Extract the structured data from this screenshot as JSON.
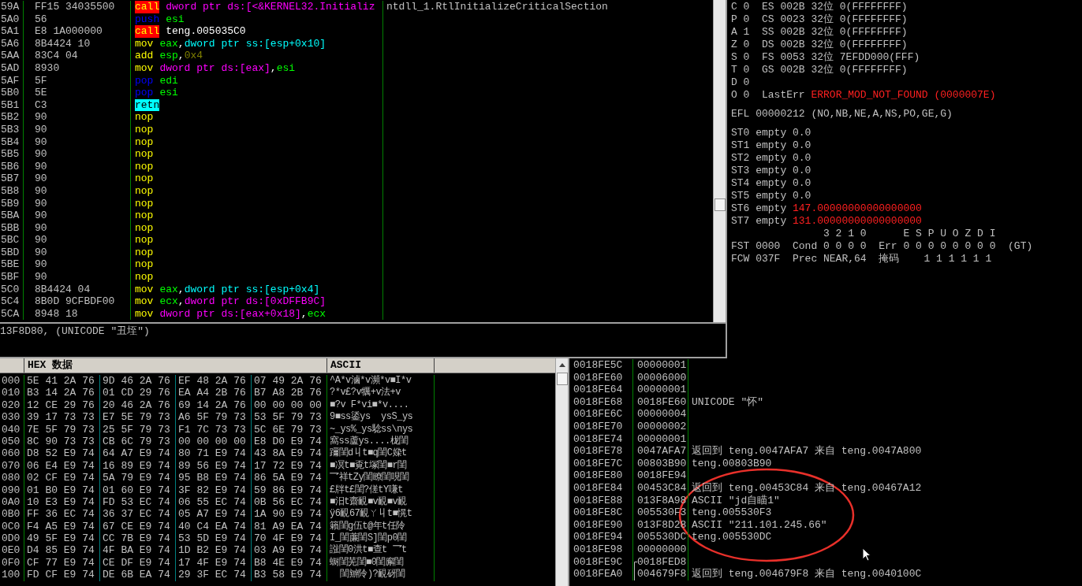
{
  "disassembly": {
    "rows": [
      {
        "addr": "59A",
        "hex": "FF15 34035500",
        "mnemonic": "call",
        "kind": "call",
        "operands": [
          {
            "text": "dword ptr ds:[<&KERNEL32.Initializ",
            "kind": "mem_ds"
          }
        ],
        "comment": "ntdll_1.RtlInitializeCriticalSection"
      },
      {
        "addr": "5A0",
        "hex": "56",
        "mnemonic": "push",
        "kind": "stack",
        "operands": [
          {
            "text": "esi",
            "kind": "reg"
          }
        ]
      },
      {
        "addr": "5A1",
        "hex": "E8 1A000000",
        "mnemonic": "call",
        "kind": "call",
        "operands": [
          {
            "text": "teng.005035C0",
            "kind": "sym"
          }
        ]
      },
      {
        "addr": "5A6",
        "hex": "8B4424 10",
        "mnemonic": "mov",
        "kind": "plain",
        "operands": [
          {
            "text": "eax",
            "kind": "reg"
          },
          {
            "text": ",",
            "kind": "sym"
          },
          {
            "text": "dword ptr ss:[esp+0x10]",
            "kind": "mem_ss"
          }
        ]
      },
      {
        "addr": "5AA",
        "hex": "83C4 04",
        "mnemonic": "add",
        "kind": "plain",
        "operands": [
          {
            "text": "esp",
            "kind": "reg"
          },
          {
            "text": ",",
            "kind": "sym"
          },
          {
            "text": "0x4",
            "kind": "imm"
          }
        ]
      },
      {
        "addr": "5AD",
        "hex": "8930",
        "mnemonic": "mov",
        "kind": "plain",
        "operands": [
          {
            "text": "dword ptr ds:[eax]",
            "kind": "mem_ds"
          },
          {
            "text": ",",
            "kind": "sym"
          },
          {
            "text": "esi",
            "kind": "reg"
          }
        ]
      },
      {
        "addr": "5AF",
        "hex": "5F",
        "mnemonic": "pop",
        "kind": "stack",
        "operands": [
          {
            "text": "edi",
            "kind": "reg"
          }
        ]
      },
      {
        "addr": "5B0",
        "hex": "5E",
        "mnemonic": "pop",
        "kind": "stack",
        "operands": [
          {
            "text": "esi",
            "kind": "reg"
          }
        ]
      },
      {
        "addr": "5B1",
        "hex": "C3",
        "mnemonic": "retn",
        "kind": "return",
        "operands": []
      },
      {
        "addr": "5B2",
        "hex": "90",
        "mnemonic": "nop",
        "kind": "plain",
        "operands": []
      },
      {
        "addr": "5B3",
        "hex": "90",
        "mnemonic": "nop",
        "kind": "plain",
        "operands": []
      },
      {
        "addr": "5B4",
        "hex": "90",
        "mnemonic": "nop",
        "kind": "plain",
        "operands": []
      },
      {
        "addr": "5B5",
        "hex": "90",
        "mnemonic": "nop",
        "kind": "plain",
        "operands": []
      },
      {
        "addr": "5B6",
        "hex": "90",
        "mnemonic": "nop",
        "kind": "plain",
        "operands": []
      },
      {
        "addr": "5B7",
        "hex": "90",
        "mnemonic": "nop",
        "kind": "plain",
        "operands": []
      },
      {
        "addr": "5B8",
        "hex": "90",
        "mnemonic": "nop",
        "kind": "plain",
        "operands": []
      },
      {
        "addr": "5B9",
        "hex": "90",
        "mnemonic": "nop",
        "kind": "plain",
        "operands": []
      },
      {
        "addr": "5BA",
        "hex": "90",
        "mnemonic": "nop",
        "kind": "plain",
        "operands": []
      },
      {
        "addr": "5BB",
        "hex": "90",
        "mnemonic": "nop",
        "kind": "plain",
        "operands": []
      },
      {
        "addr": "5BC",
        "hex": "90",
        "mnemonic": "nop",
        "kind": "plain",
        "operands": []
      },
      {
        "addr": "5BD",
        "hex": "90",
        "mnemonic": "nop",
        "kind": "plain",
        "operands": []
      },
      {
        "addr": "5BE",
        "hex": "90",
        "mnemonic": "nop",
        "kind": "plain",
        "operands": []
      },
      {
        "addr": "5BF",
        "hex": "90",
        "mnemonic": "nop",
        "kind": "plain",
        "operands": []
      },
      {
        "addr": "5C0",
        "hex": "8B4424 04",
        "mnemonic": "mov",
        "kind": "plain",
        "operands": [
          {
            "text": "eax",
            "kind": "reg"
          },
          {
            "text": ",",
            "kind": "sym"
          },
          {
            "text": "dword ptr ss:[esp+0x4]",
            "kind": "mem_ss"
          }
        ]
      },
      {
        "addr": "5C4",
        "hex": "8B0D 9CFBDF00",
        "mnemonic": "mov",
        "kind": "plain",
        "operands": [
          {
            "text": "ecx",
            "kind": "reg"
          },
          {
            "text": ",",
            "kind": "sym"
          },
          {
            "text": "dword ptr ds:[0xDFFB9C]",
            "kind": "mem_ds"
          }
        ]
      },
      {
        "addr": "5CA",
        "hex": "8948 18",
        "mnemonic": "mov",
        "kind": "plain",
        "operands": [
          {
            "text": "dword ptr ds:[eax+0x18]",
            "kind": "mem_ds"
          },
          {
            "text": ",",
            "kind": "sym"
          },
          {
            "text": "ecx",
            "kind": "reg"
          }
        ]
      }
    ],
    "info": "13F8D80, (UNICODE \"丑垤\")"
  },
  "registers": {
    "groups": [
      {
        "lines": [
          [
            {
              "text": "C 0  ES 002B 32位 0(FFFFFFFF)",
              "kind": "plain"
            }
          ],
          [
            {
              "text": "P 0  CS 0023 32位 0(FFFFFFFF)",
              "kind": "plain"
            }
          ],
          [
            {
              "text": "A 1  SS 002B 32位 0(FFFFFFFF)",
              "kind": "plain"
            }
          ],
          [
            {
              "text": "Z 0  DS 002B 32位 0(FFFFFFFF)",
              "kind": "plain"
            }
          ],
          [
            {
              "text": "S 0  FS 0053 32位 7EFDD000(FFF)",
              "kind": "plain"
            }
          ],
          [
            {
              "text": "T 0  GS 002B 32位 0(FFFFFFFF)",
              "kind": "plain"
            }
          ],
          [
            {
              "text": "D 0",
              "kind": "plain"
            }
          ],
          [
            {
              "text": "O 0  LastErr ",
              "kind": "plain"
            },
            {
              "text": "ERROR_MOD_NOT_FOUND (0000007E)",
              "kind": "error"
            }
          ]
        ]
      },
      {
        "lines": [
          [
            {
              "text": "EFL 00000212 (NO,NB,NE,A,NS,PO,GE,G)",
              "kind": "plain"
            }
          ]
        ]
      },
      {
        "lines": [
          [
            {
              "text": "ST0 empty 0.0",
              "kind": "plain"
            }
          ],
          [
            {
              "text": "ST1 empty 0.0",
              "kind": "plain"
            }
          ],
          [
            {
              "text": "ST2 empty 0.0",
              "kind": "plain"
            }
          ],
          [
            {
              "text": "ST3 empty 0.0",
              "kind": "plain"
            }
          ],
          [
            {
              "text": "ST4 empty 0.0",
              "kind": "plain"
            }
          ],
          [
            {
              "text": "ST5 empty 0.0",
              "kind": "plain"
            }
          ],
          [
            {
              "text": "ST6 empty ",
              "kind": "plain"
            },
            {
              "text": "147.00000000000000000",
              "kind": "error"
            }
          ],
          [
            {
              "text": "ST7 empty ",
              "kind": "plain"
            },
            {
              "text": "131.00000000000000000",
              "kind": "error"
            }
          ],
          [
            {
              "text": "               3 2 1 0      E S P U O Z D I",
              "kind": "plain"
            }
          ],
          [
            {
              "text": "FST 0000  Cond 0 0 0 0  Err 0 0 0 0 0 0 0 0  (GT)",
              "kind": "plain"
            }
          ],
          [
            {
              "text": "FCW 037F  Prec NEAR,64  掩码    1 1 1 1 1 1",
              "kind": "plain"
            }
          ]
        ]
      }
    ]
  },
  "dump": {
    "columns": [
      "HEX 数据",
      "ASCII"
    ],
    "rows": [
      {
        "addr": "000",
        "bytes": [
          "5E 41 2A 76",
          "9D 46 2A 76",
          "EF 48 2A 76",
          "07 49 2A 76"
        ],
        "ascii": "^A*v滷*v瀕*v■I*v"
      },
      {
        "addr": "010",
        "bytes": [
          "B3 14 2A 76",
          "01 CD 29 76",
          "EA A4 2B 76",
          "B7 A8 2B 76"
        ],
        "ascii": "?*v£?v犡+v法+v"
      },
      {
        "addr": "020",
        "bytes": [
          "12 CE 29 76",
          "20 46 2A 76",
          "69 14 2A 76",
          "00 00 00 00"
        ],
        "ascii": "■?v F*vi■*v...."
      },
      {
        "addr": "030",
        "bytes": [
          "39 17 73 73",
          "E7 5E 79 73",
          "A6 5F 79 73",
          "53 5F 79 73"
        ],
        "ascii": "9■ss鋈ys  ysS_ys"
      },
      {
        "addr": "040",
        "bytes": [
          "7E 5F 79 73",
          "25 5F 79 73",
          "F1 7C 73 73",
          "5C 6E 79 73"
        ],
        "ascii": "~_ys%_ys騐ss\\nys"
      },
      {
        "addr": "050",
        "bytes": [
          "8C 90 73 73",
          "CB 6C 79 73",
          "00 00 00 00",
          "E8 D0 E9 74"
        ],
        "ascii": "窩ss蘆ys....栊閨"
      },
      {
        "addr": "060",
        "bytes": [
          "D8 52 E9 74",
          "64 A7 E9 74",
          "80 71 E9 74",
          "43 8A E9 74"
        ],
        "ascii": "躎閨d丩t■q閨C媣t"
      },
      {
        "addr": "070",
        "bytes": [
          "06 E4 E9 74",
          "16 89 E9 74",
          "89 56 E9 74",
          "17 72 E9 74"
        ],
        "ascii": "■凕t■覔t塚閨■r閨"
      },
      {
        "addr": "080",
        "bytes": [
          "02 CF E9 74",
          "5A 79 E9 74",
          "95 B8 E9 74",
          "86 5A E9 74"
        ],
        "ascii": "乛祥tZy閨瞭閨哯閨"
      },
      {
        "addr": "090",
        "bytes": [
          "01 B0 E9 74",
          "01 60 E9 74",
          "3F 82 E9 74",
          "59 86 E9 74"
        ],
        "ascii": "£牉t£閨?傞tY嗛t"
      },
      {
        "addr": "0A0",
        "bytes": [
          "10 E3 E9 74",
          "FD 53 EC 74",
          "06 55 EC 74",
          "0B 56 EC 74"
        ],
        "ascii": "■汨t齋靦■v靦■v靦"
      },
      {
        "addr": "0B0",
        "bytes": [
          "FF 36 EC 74",
          "36 37 EC 74",
          "05 A7 E9 74",
          "1A 90 E9 74"
        ],
        "ascii": "ÿ6靦67靦ㄚ丩t■愰t"
      },
      {
        "addr": "0C0",
        "bytes": [
          "F4 A5 E9 74",
          "67 CE E9 74",
          "40 C4 EA 74",
          "81 A9 EA 74"
        ],
        "ascii": "籟閨g伍t@年t任阾"
      },
      {
        "addr": "0D0",
        "bytes": [
          "49 5F E9 74",
          "CC 7B E9 74",
          "53 5D E9 74",
          "70 4F E9 74"
        ],
        "ascii": "I_閨薕閨S]閨p0閨"
      },
      {
        "addr": "0E0",
        "bytes": [
          "D4 85 E9 74",
          "4F BA E9 74",
          "1D B2 E9 74",
          "03 A9 E9 74"
        ],
        "ascii": "誸閨0洪t■查t 乛t"
      },
      {
        "addr": "0F0",
        "bytes": [
          "CF 77 E9 74",
          "CE DF E9 74",
          "17 4F E9 74",
          "B8 4E E9 74"
        ],
        "ascii": "蟵閨芜閨■0閨廨閨"
      },
      {
        "addr": "100",
        "bytes": [
          "FD CF E9 74",
          "DE 6B EA 74",
          "29 3F EC 74",
          "B3 58 E9 74"
        ],
        "ascii": "  閨辧阾)?靦砑閨"
      }
    ]
  },
  "stack": {
    "rows": [
      {
        "addr": "0018FE5C",
        "value": "00000001"
      },
      {
        "addr": "0018FE60",
        "value": "00006000"
      },
      {
        "addr": "0018FE64",
        "value": "00000001"
      },
      {
        "addr": "0018FE68",
        "value": "0018FE60",
        "comment": "UNICODE \"怀\""
      },
      {
        "addr": "0018FE6C",
        "value": "00000004"
      },
      {
        "addr": "0018FE70",
        "value": "00000002"
      },
      {
        "addr": "0018FE74",
        "value": "00000001"
      },
      {
        "addr": "0018FE78",
        "value": "0047AFA7",
        "comment": "返回到 teng.0047AFA7 来自 teng.0047A800"
      },
      {
        "addr": "0018FE7C",
        "value": "00803B90",
        "comment": "teng.00803B90"
      },
      {
        "addr": "0018FE80",
        "value": "0018FE94"
      },
      {
        "addr": "0018FE84",
        "value": "00453C84",
        "comment": "返回到 teng.00453C84 来自 teng.00467A12"
      },
      {
        "addr": "0018FE88",
        "value": "013F8A98",
        "comment": "ASCII \"jd自瞄1\""
      },
      {
        "addr": "0018FE8C",
        "value": "005530F3",
        "comment": "teng.005530F3"
      },
      {
        "addr": "0018FE90",
        "value": "013F8D28",
        "comment": "ASCII \"211.101.245.66\""
      },
      {
        "addr": "0018FE94",
        "value": "005530DC",
        "comment": "teng.005530DC"
      },
      {
        "addr": "0018FE98",
        "value": "00000000"
      },
      {
        "addr": "0018FE9C",
        "value": "0018FED8",
        "kind": "frame_start"
      },
      {
        "addr": "0018FEA0",
        "value": "004679F8",
        "kind": "frame_continue",
        "comment": "返回到 teng.004679F8 来自 teng.0040100C"
      }
    ]
  }
}
